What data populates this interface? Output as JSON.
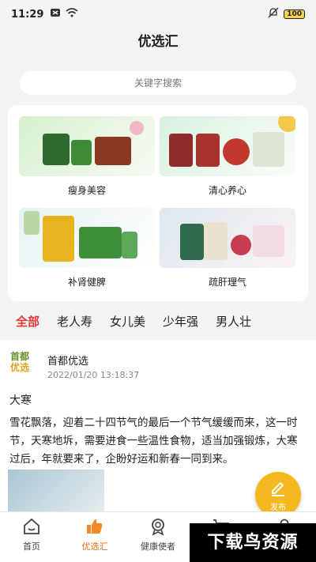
{
  "status_bar": {
    "time": "11:29",
    "battery": "100"
  },
  "header": {
    "title": "优选汇"
  },
  "search": {
    "placeholder": "关键字搜索"
  },
  "categories_grid": [
    {
      "label": "瘦身美容"
    },
    {
      "label": "清心养心"
    },
    {
      "label": "补肾健脾"
    },
    {
      "label": "疏肝理气"
    }
  ],
  "filter_tabs": [
    {
      "label": "全部",
      "active": true
    },
    {
      "label": "老人寿"
    },
    {
      "label": "女儿美"
    },
    {
      "label": "少年强"
    },
    {
      "label": "男人壮"
    }
  ],
  "post": {
    "logo_line1": "首都",
    "logo_line2": "优选",
    "author": "首都优选",
    "time": "2022/01/20 13:18:37",
    "title": "大寒",
    "body": "雪花飘落，迎着二十四节气的最后一个节气缓缓而来，这一时节，天寒地坼，需要进食一些温性食物，适当加强锻炼，大寒过后，年就要来了，企盼好运和新春一同到来。"
  },
  "fab": {
    "label": "发布"
  },
  "bottom_nav": [
    {
      "label": "首页",
      "icon": "home-icon"
    },
    {
      "label": "优选汇",
      "icon": "thumbs-up-icon",
      "active": true
    },
    {
      "label": "健康使者",
      "icon": "medal-icon"
    },
    {
      "label": "",
      "icon": "cart-icon"
    },
    {
      "label": "",
      "icon": "user-icon"
    }
  ],
  "watermark": {
    "text": "下载鸟资源"
  },
  "colors": {
    "accent": "#e0701a",
    "active_tab": "#e53935",
    "fab": "#f5b820"
  }
}
